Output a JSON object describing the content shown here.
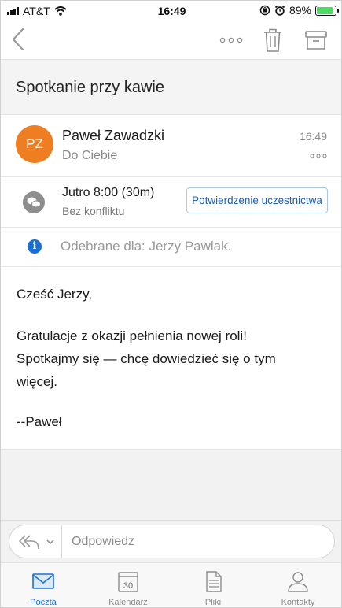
{
  "status_bar": {
    "carrier": "AT&T",
    "time": "16:49",
    "battery": "89%"
  },
  "toolbar": {
    "back_icon": "chevron-left-icon",
    "more_icon": "more-icon",
    "delete_icon": "trash-icon",
    "archive_icon": "archive-icon"
  },
  "subject": "Spotkanie przy kawie",
  "sender": {
    "initials": "PZ",
    "name": "Paweł Zawadzki",
    "to": "Do Ciebie",
    "time": "16:49",
    "avatar_color": "#ef7d22"
  },
  "meeting": {
    "when": "Jutro 8:00 (30m)",
    "conflict": "Bez konfliktu",
    "rsvp_label": "Potwierdzenie uczestnictwa"
  },
  "received": {
    "info_glyph": "i",
    "text": "Odebrane dla: Jerzy Pawlak."
  },
  "body": {
    "greeting": "Cześć Jerzy,",
    "line1": "Gratulacje z okazji pełnienia nowej roli!",
    "line2": "Spotkajmy się — chcę dowiedzieć się o tym",
    "line3": "więcej.",
    "signature": "--Paweł"
  },
  "reply": {
    "placeholder": "Odpowiedz"
  },
  "tabs": [
    {
      "label": "Poczta",
      "icon": "mail-icon",
      "active": true
    },
    {
      "label": "Kalendarz",
      "icon": "calendar-icon",
      "day": "30",
      "active": false
    },
    {
      "label": "Pliki",
      "icon": "file-icon",
      "active": false
    },
    {
      "label": "Kontakty",
      "icon": "contacts-icon",
      "active": false
    }
  ],
  "colors": {
    "accent": "#1a6fd6",
    "battery": "#4cd964"
  }
}
